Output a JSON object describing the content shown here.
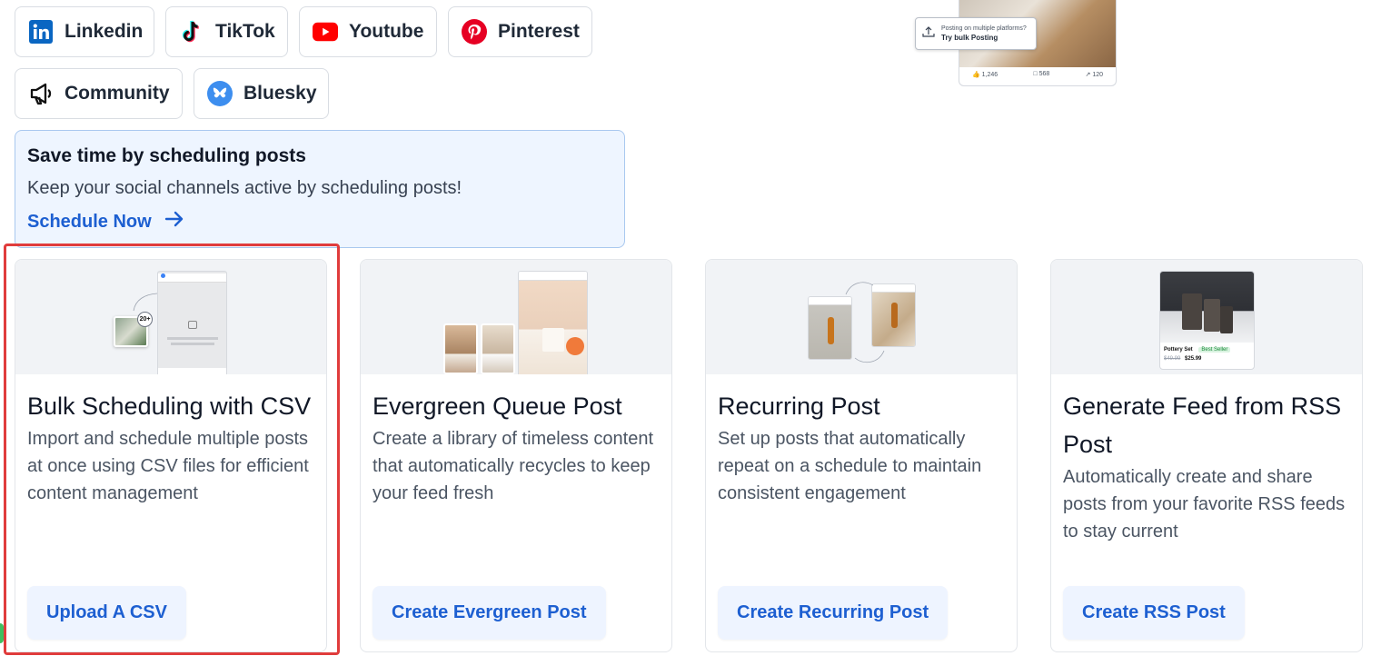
{
  "platforms": [
    {
      "label": "Linkedin",
      "icon": "linkedin-icon"
    },
    {
      "label": "TikTok",
      "icon": "tiktok-icon"
    },
    {
      "label": "Youtube",
      "icon": "youtube-icon"
    },
    {
      "label": "Pinterest",
      "icon": "pinterest-icon"
    },
    {
      "label": "Community",
      "icon": "megaphone-icon"
    },
    {
      "label": "Bluesky",
      "icon": "bluesky-icon"
    }
  ],
  "preview": {
    "tooltip_line1": "Posting on multiple platforms?",
    "tooltip_line2": "Try bulk Posting",
    "likes": "1,246",
    "comments": "568",
    "shares": "120"
  },
  "banner": {
    "title": "Save time by scheduling posts",
    "description": "Keep your social channels active by scheduling posts!",
    "cta": "Schedule Now"
  },
  "cards": [
    {
      "title": "Bulk Scheduling with CSV",
      "description": "Import and schedule multiple posts at once using CSV files for efficient content management",
      "button": "Upload A CSV",
      "badge": "20+"
    },
    {
      "title": "Evergreen Queue Post",
      "description": "Create a library of timeless content that automatically recycles to keep your feed fresh",
      "button": "Create Evergreen Post"
    },
    {
      "title": "Recurring Post",
      "description": "Set up posts that automatically repeat on a schedule to maintain consistent engagement",
      "button": "Create Recurring Post"
    },
    {
      "title": "Generate Feed from RSS Post",
      "description": "Automatically create and share posts from your favorite RSS feeds to stay current",
      "button": "Create RSS Post",
      "product_name": "Pottery Set",
      "product_badge": "Best Seller",
      "old_price": "$49.99",
      "new_price": "$25.99"
    }
  ],
  "colors": {
    "accent": "#1d5fd1",
    "highlight": "#e03c3c",
    "banner_bg": "#eef5ff",
    "button_bg": "#eef4ff"
  }
}
